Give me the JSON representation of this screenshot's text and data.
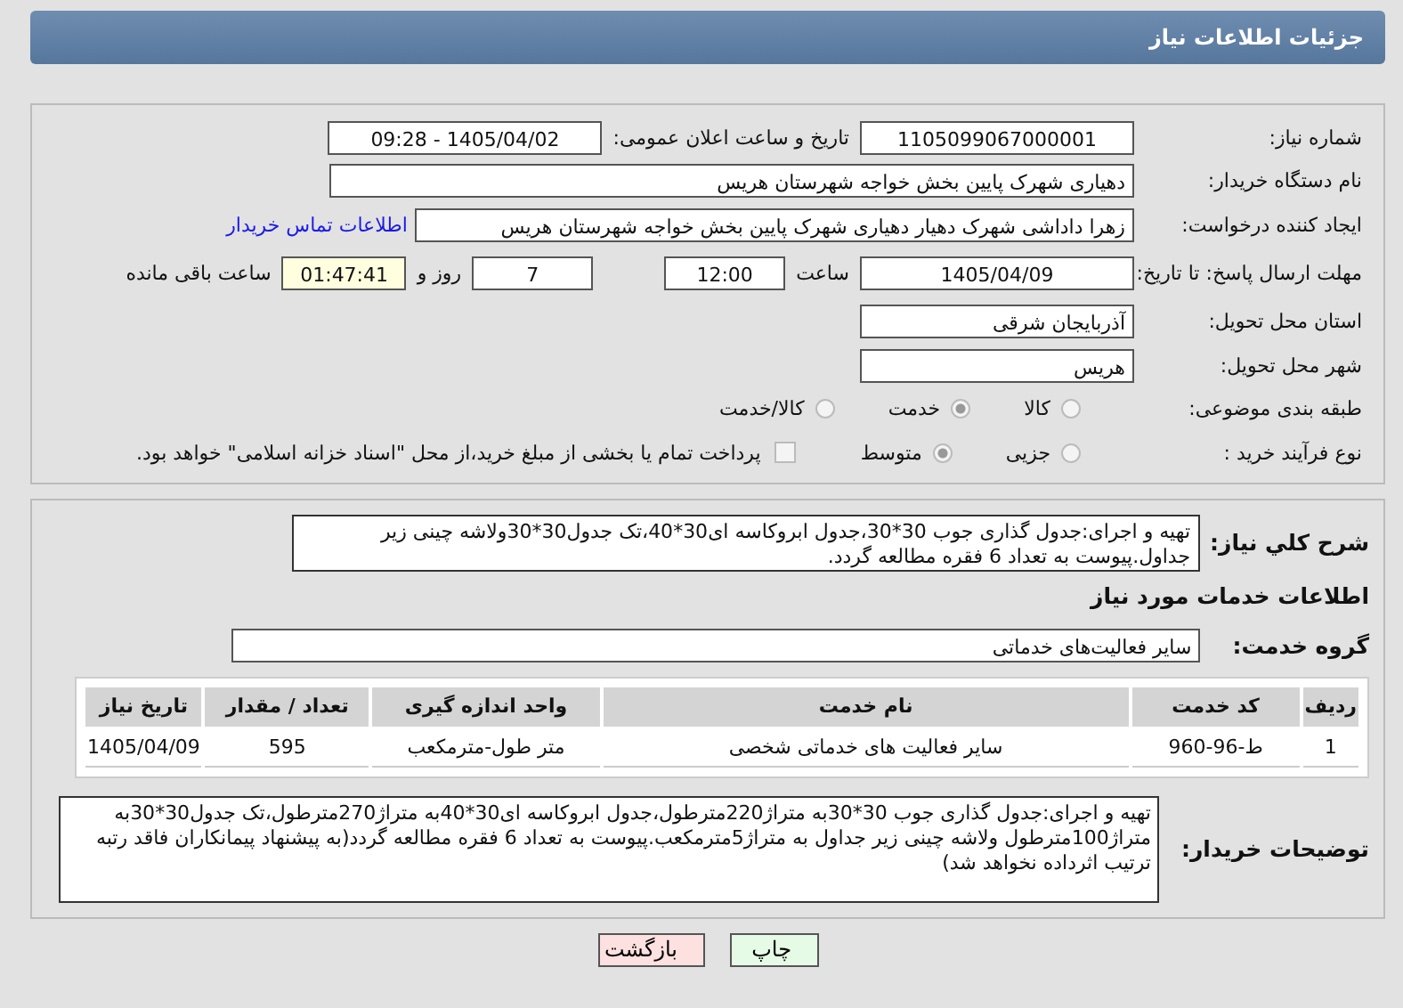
{
  "header": {
    "title": "جزئیات اطلاعات نیاز"
  },
  "need_number": {
    "label": "شماره نیاز:",
    "value": "1105099067000001"
  },
  "announce": {
    "label": "تاریخ و ساعت اعلان عمومی:",
    "value": "1405/04/02 - 09:28"
  },
  "buyer": {
    "label": "نام دستگاه خریدار:",
    "value": "دهیاری شهرک پایین بخش خواجه شهرستان هریس"
  },
  "creator": {
    "label": "ایجاد کننده درخواست:",
    "value": "زهرا داداشی شهرک دهیار دهیاری شهرک پایین بخش خواجه شهرستان هریس",
    "link": "اطلاعات تماس خریدار"
  },
  "deadline": {
    "label": "مهلت ارسال پاسخ: تا تاریخ:",
    "date": "1405/04/09",
    "time_label": "ساعت",
    "time": "12:00",
    "days": "7",
    "days_label": "روز و",
    "remaining": "01:47:41",
    "remaining_label": "ساعت باقی مانده"
  },
  "province": {
    "label": "استان محل تحویل:",
    "value": "آذربایجان شرقی"
  },
  "city": {
    "label": "شهر محل تحویل:",
    "value": "هریس"
  },
  "category": {
    "label": "طبقه بندی موضوعی:",
    "options": [
      {
        "label": "کالا",
        "selected": false
      },
      {
        "label": "خدمت",
        "selected": true
      },
      {
        "label": "کالا/خدمت",
        "selected": false
      }
    ]
  },
  "process": {
    "label": "نوع فرآیند خرید :",
    "options": [
      {
        "label": "جزیی",
        "selected": false
      },
      {
        "label": "متوسط",
        "selected": true
      }
    ],
    "payment": {
      "checked": false,
      "text": "پرداخت تمام یا بخشی از مبلغ خرید،از محل \"اسناد خزانه اسلامی\" خواهد بود."
    }
  },
  "summary": {
    "label": "شرح کلي نیاز:",
    "value": "تهیه و اجرای:جدول گذاری جوب 30*30،جدول ابروکاسه ای30*40،تک جدول30*30ولاشه چینی زیر جداول.پیوست به تعداد 6 فقره مطالعه گردد."
  },
  "services_title": "اطلاعات خدمات مورد نیاز",
  "service_group": {
    "label": "گروه خدمت:",
    "value": "سایر فعالیت‌های خدماتی"
  },
  "table": {
    "columns": [
      "ردیف",
      "کد خدمت",
      "نام خدمت",
      "واحد اندازه گیری",
      "تعداد / مقدار",
      "تاریخ نیاز"
    ],
    "rows": [
      [
        "1",
        "ط-96-960",
        "سایر فعالیت های خدماتی شخصی",
        "متر طول-مترمکعب",
        "595",
        "1405/04/09"
      ]
    ]
  },
  "notes": {
    "label": "توضیحات خریدار:",
    "value": "تهیه و اجرای:جدول گذاری جوب 30*30به متراژ220مترطول،جدول ابروکاسه ای30*40به متراژ270مترطول،تک جدول30*30به متراژ100مترطول ولاشه چینی زیر جداول به متراژ5مترمکعب.پیوست به تعداد 6 فقره مطالعه گردد(به پیشنهاد پیمانکاران فاقد رتبه ترتیب اثرداده نخواهد شد)"
  },
  "buttons": [
    {
      "label": "چاپ",
      "kind": "print"
    },
    {
      "label": "بازگشت",
      "kind": "back"
    }
  ]
}
